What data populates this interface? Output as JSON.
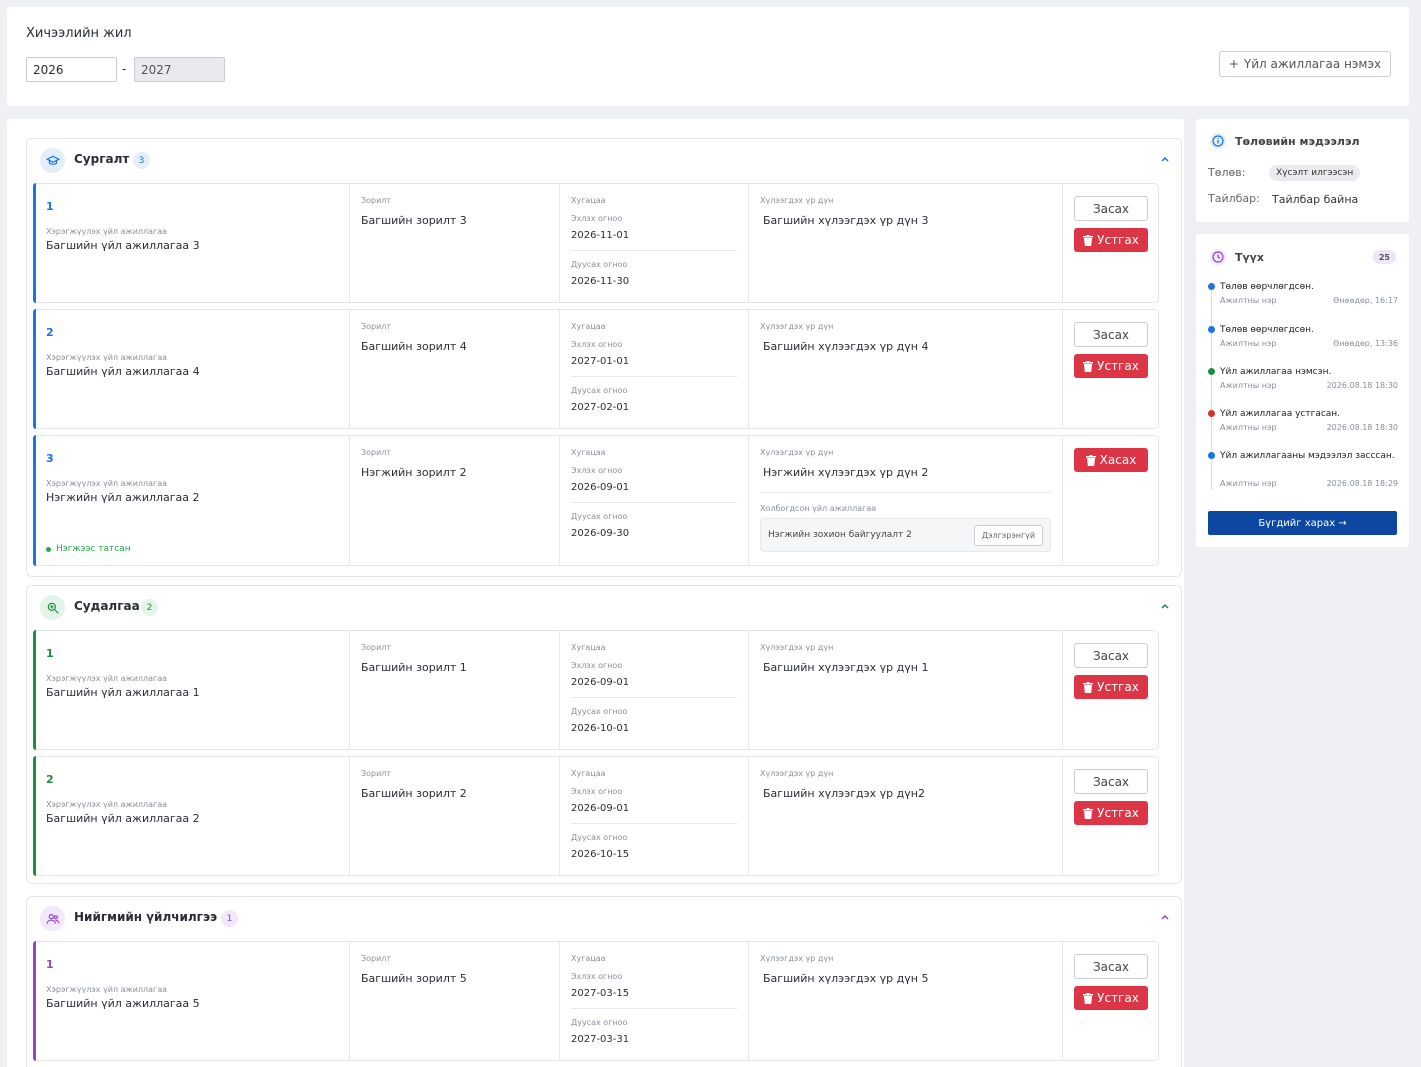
{
  "year": {
    "label": "Хичээлийн жил",
    "start": "2026",
    "end": "2027",
    "separator": "-"
  },
  "add_button_label": "Үйл ажиллагаа нэмэх",
  "labels": {
    "activity": "Хэрэгжүүлэх үйл ажиллагаа",
    "goal": "Зорилт",
    "duration": "Хугацаа",
    "start_date": "Эхлэх огноо",
    "end_date": "Дуусах огноо",
    "result": "Хүлээгдэх үр дүн",
    "linked": "Холбогдсон үйл ажиллагаа",
    "edit": "Засах",
    "delete": "Устгах",
    "remove": "Хасах",
    "details": "Дэлгэрэнгүй",
    "revoked": "Нэгжээс татсан"
  },
  "sections": [
    {
      "title": "Сургалт",
      "count": "3",
      "rows": [
        {
          "num": "1",
          "activity": "Багшийн үйл ажиллагаа 3",
          "goal": "Багшийн зорилт 3",
          "start": "2026-11-01",
          "end": "2026-11-30",
          "result": "Багшийн хүлээгдэх үр дүн 3"
        },
        {
          "num": "2",
          "activity": "Багшийн үйл ажиллагаа 4",
          "goal": "Багшийн зорилт 4",
          "start": "2027-01-01",
          "end": "2027-02-01",
          "result": "Багшийн хүлээгдэх үр дүн 4"
        },
        {
          "num": "3",
          "activity": "Нэгжийн үйл ажиллагаа 2",
          "goal": "Нэгжийн зорилт 2",
          "start": "2026-09-01",
          "end": "2026-09-30",
          "result": "Нэгжийн хүлээгдэх үр дүн 2",
          "linked_name": "Нэгжийн зохион байгуулалт 2"
        }
      ]
    },
    {
      "title": "Судалгаа",
      "count": "2",
      "rows": [
        {
          "num": "1",
          "activity": "Багшийн үйл ажиллагаа 1",
          "goal": "Багшийн зорилт 1",
          "start": "2026-09-01",
          "end": "2026-10-01",
          "result": "Багшийн хүлээгдэх үр дүн 1"
        },
        {
          "num": "2",
          "activity": "Багшийн үйл ажиллагаа 2",
          "goal": "Багшийн зорилт 2",
          "start": "2026-09-01",
          "end": "2026-10-15",
          "result": "Багшийн хүлээгдэх үр дүн2"
        }
      ]
    },
    {
      "title": "Нийгмийн үйлчилгээ",
      "count": "1",
      "rows": [
        {
          "num": "1",
          "activity": "Багшийн үйл ажиллагаа 5",
          "goal": "Багшийн зорилт 5",
          "start": "2027-03-15",
          "end": "2027-03-31",
          "result": "Багшийн хүлээгдэх үр дүн 5"
        }
      ]
    }
  ],
  "status": {
    "title": "Төлөвийн мэдээлэл",
    "status_label": "Төлөв:",
    "status_value": "Хүсэлт илгээсэн",
    "desc_label": "Тайлбар:",
    "desc_value": "Тайлбар байна"
  },
  "history": {
    "title": "Түүх",
    "count": "25",
    "items": [
      {
        "text": "Төлөв өөрчлөгдсөн.",
        "user": "Ажилтны нэр",
        "time": "Өнөөдөр, 16:17",
        "color": "#1a73e8"
      },
      {
        "text": "Төлөв өөрчлөгдсөн.",
        "user": "Ажилтны нэр",
        "time": "Өнөөдөр, 13:36",
        "color": "#1a73e8"
      },
      {
        "text": "Үйл ажиллагаа нэмсэн.",
        "user": "Ажилтны нэр",
        "time": "2026.08.18 18:30",
        "color": "#1e8e3e"
      },
      {
        "text": "Үйл ажиллагаа устгасан.",
        "user": "Ажилтны нэр",
        "time": "2026.08.18 18:30",
        "color": "#d93025"
      },
      {
        "text": "Үйл ажиллагааны мэдээлэл засссан.",
        "user": "Ажилтны нэр",
        "time": "2026.08.18 18:29",
        "color": "#1a73e8"
      }
    ],
    "view_all": "Бүгдийг харах →"
  },
  "colors": {
    "training": "#1a73e8",
    "research": "#1e8e3e",
    "service": "#8e44c9",
    "danger": "#dc3545",
    "primary": "#0d47a1"
  }
}
